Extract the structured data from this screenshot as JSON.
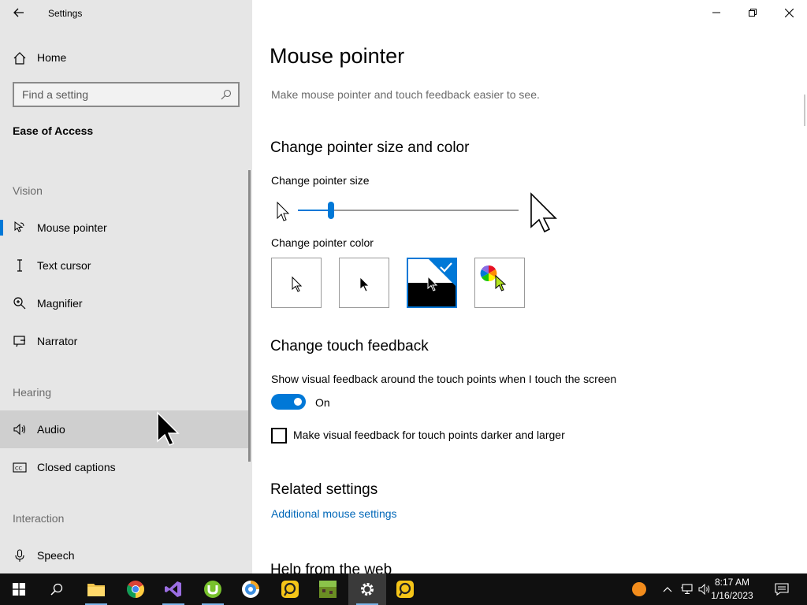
{
  "window": {
    "app_title": "Settings",
    "controls": [
      "minimize",
      "restore",
      "close"
    ]
  },
  "sidebar": {
    "home_label": "Home",
    "search_placeholder": "Find a setting",
    "section_title": "Ease of Access",
    "groups": {
      "vision": "Vision",
      "hearing": "Hearing",
      "interaction": "Interaction"
    },
    "items": [
      {
        "label": "Mouse pointer",
        "icon": "mouse-pointer-icon",
        "active": true
      },
      {
        "label": "Text cursor",
        "icon": "text-cursor-icon"
      },
      {
        "label": "Magnifier",
        "icon": "magnifier-icon"
      },
      {
        "label": "Narrator",
        "icon": "narrator-icon"
      },
      {
        "label": "Audio",
        "icon": "speaker-icon",
        "hover": true
      },
      {
        "label": "Closed captions",
        "icon": "closed-captions-icon"
      },
      {
        "label": "Speech",
        "icon": "microphone-icon"
      }
    ]
  },
  "main": {
    "title": "Mouse pointer",
    "subtitle": "Make mouse pointer and touch feedback easier to see.",
    "size_color_heading": "Change pointer size and color",
    "size_label": "Change pointer size",
    "size_value_fraction": 0.15,
    "color_label": "Change pointer color",
    "color_options": [
      "white",
      "black",
      "inverted",
      "custom"
    ],
    "color_selected": "inverted",
    "touch_heading": "Change touch feedback",
    "touch_label": "Show visual feedback around the touch points when I touch the screen",
    "touch_toggle_state": "On",
    "touch_darker_label": "Make visual feedback for touch points darker and larger",
    "touch_darker_checked": false,
    "related_heading": "Related settings",
    "related_link": "Additional mouse settings",
    "help_heading": "Help from the web"
  },
  "taskbar": {
    "apps": [
      "start",
      "search",
      "file-explorer",
      "chrome",
      "visual-studio",
      "utorrent",
      "browser",
      "app-yellow",
      "minecraft",
      "settings",
      "app-yellow-2"
    ],
    "active_app": "settings",
    "time": "8:17 AM",
    "date": "1/16/2023"
  },
  "colors": {
    "accent": "#0078d7",
    "link": "#0067b8",
    "sidebar_bg": "#e6e6e6"
  }
}
